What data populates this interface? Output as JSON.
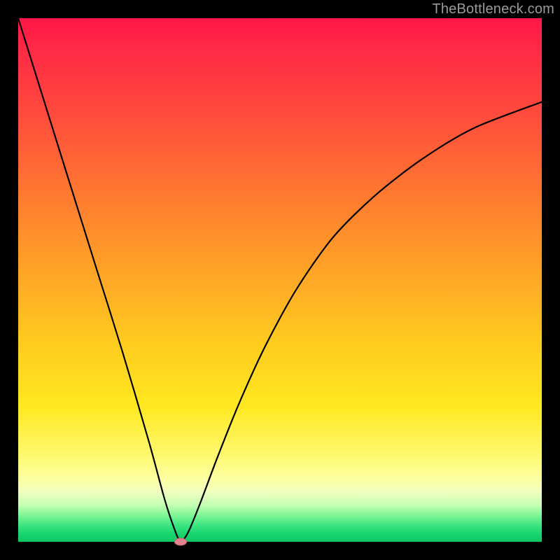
{
  "watermark": "TheBottleneck.com",
  "colors": {
    "frame": "#000000",
    "curve": "#000000",
    "marker": "#e6818e"
  },
  "chart_data": {
    "type": "line",
    "title": "",
    "xlabel": "",
    "ylabel": "",
    "xlim": [
      0,
      100
    ],
    "ylim": [
      0,
      100
    ],
    "grid": false,
    "legend": false,
    "series": [
      {
        "name": "bottleneck-curve",
        "x": [
          0,
          5,
          10,
          15,
          20,
          25,
          28,
          30,
          31,
          32,
          33,
          35,
          38,
          42,
          47,
          53,
          60,
          68,
          77,
          87,
          100
        ],
        "values": [
          100,
          84,
          68,
          52,
          36,
          19,
          8,
          2,
          0,
          1,
          3,
          8,
          16,
          26,
          37,
          48,
          58,
          66,
          73,
          79,
          84
        ]
      }
    ],
    "marker": {
      "x": 31,
      "y": 0
    },
    "background_gradient": {
      "direction": "vertical",
      "stops": [
        {
          "pos": 0.0,
          "color": "#ff1749"
        },
        {
          "pos": 0.18,
          "color": "#ff4a3d"
        },
        {
          "pos": 0.48,
          "color": "#ffa327"
        },
        {
          "pos": 0.74,
          "color": "#ffe81f"
        },
        {
          "pos": 0.88,
          "color": "#fdffa2"
        },
        {
          "pos": 0.95,
          "color": "#7cf595"
        },
        {
          "pos": 1.0,
          "color": "#0fc665"
        }
      ]
    }
  }
}
